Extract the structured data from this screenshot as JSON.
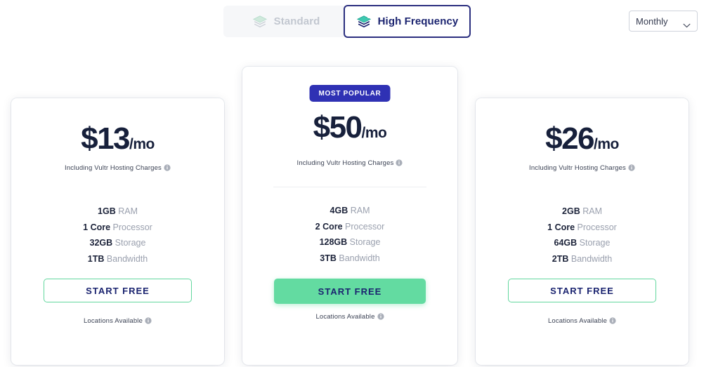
{
  "toggle": {
    "tabs": [
      {
        "label": "Standard",
        "icon": "layers-icon",
        "active": false
      },
      {
        "label": "High Frequency",
        "icon": "layers-sparkle-icon",
        "active": true
      }
    ]
  },
  "period_select": {
    "value": "Monthly",
    "icon": "chevron-down-icon"
  },
  "colors": {
    "accent_green": "#63dba1",
    "badge_blue": "#2f31b4",
    "tab_active_border": "#2b2f7f",
    "price_navy": "#17203b",
    "muted_text": "#9aa0ae"
  },
  "cards": [
    {
      "badge": null,
      "price_amount": "$13",
      "price_suffix": "/mo",
      "including_note": "Including Vultr Hosting Charges",
      "including_icon": "info-icon",
      "specs": [
        {
          "value": "1GB",
          "label": "RAM"
        },
        {
          "value": "1 Core",
          "label": "Processor"
        },
        {
          "value": "32GB",
          "label": "Storage"
        },
        {
          "value": "1TB",
          "label": "Bandwidth"
        }
      ],
      "cta_label": "START FREE",
      "cta_style": "outline",
      "locations_note": "Locations Available",
      "locations_icon": "info-icon",
      "popular": false
    },
    {
      "badge": "MOST POPULAR",
      "price_amount": "$50",
      "price_suffix": "/mo",
      "including_note": "Including Vultr Hosting Charges",
      "including_icon": "info-icon",
      "specs": [
        {
          "value": "4GB",
          "label": "RAM"
        },
        {
          "value": "2 Core",
          "label": "Processor"
        },
        {
          "value": "128GB",
          "label": "Storage"
        },
        {
          "value": "3TB",
          "label": "Bandwidth"
        }
      ],
      "cta_label": "START FREE",
      "cta_style": "filled",
      "locations_note": "Locations Available",
      "locations_icon": "info-icon",
      "popular": true
    },
    {
      "badge": null,
      "price_amount": "$26",
      "price_suffix": "/mo",
      "including_note": "Including Vultr Hosting Charges",
      "including_icon": "info-icon",
      "specs": [
        {
          "value": "2GB",
          "label": "RAM"
        },
        {
          "value": "1 Core",
          "label": "Processor"
        },
        {
          "value": "64GB",
          "label": "Storage"
        },
        {
          "value": "2TB",
          "label": "Bandwidth"
        }
      ],
      "cta_label": "START FREE",
      "cta_style": "outline",
      "locations_note": "Locations Available",
      "locations_icon": "info-icon",
      "popular": false
    }
  ]
}
